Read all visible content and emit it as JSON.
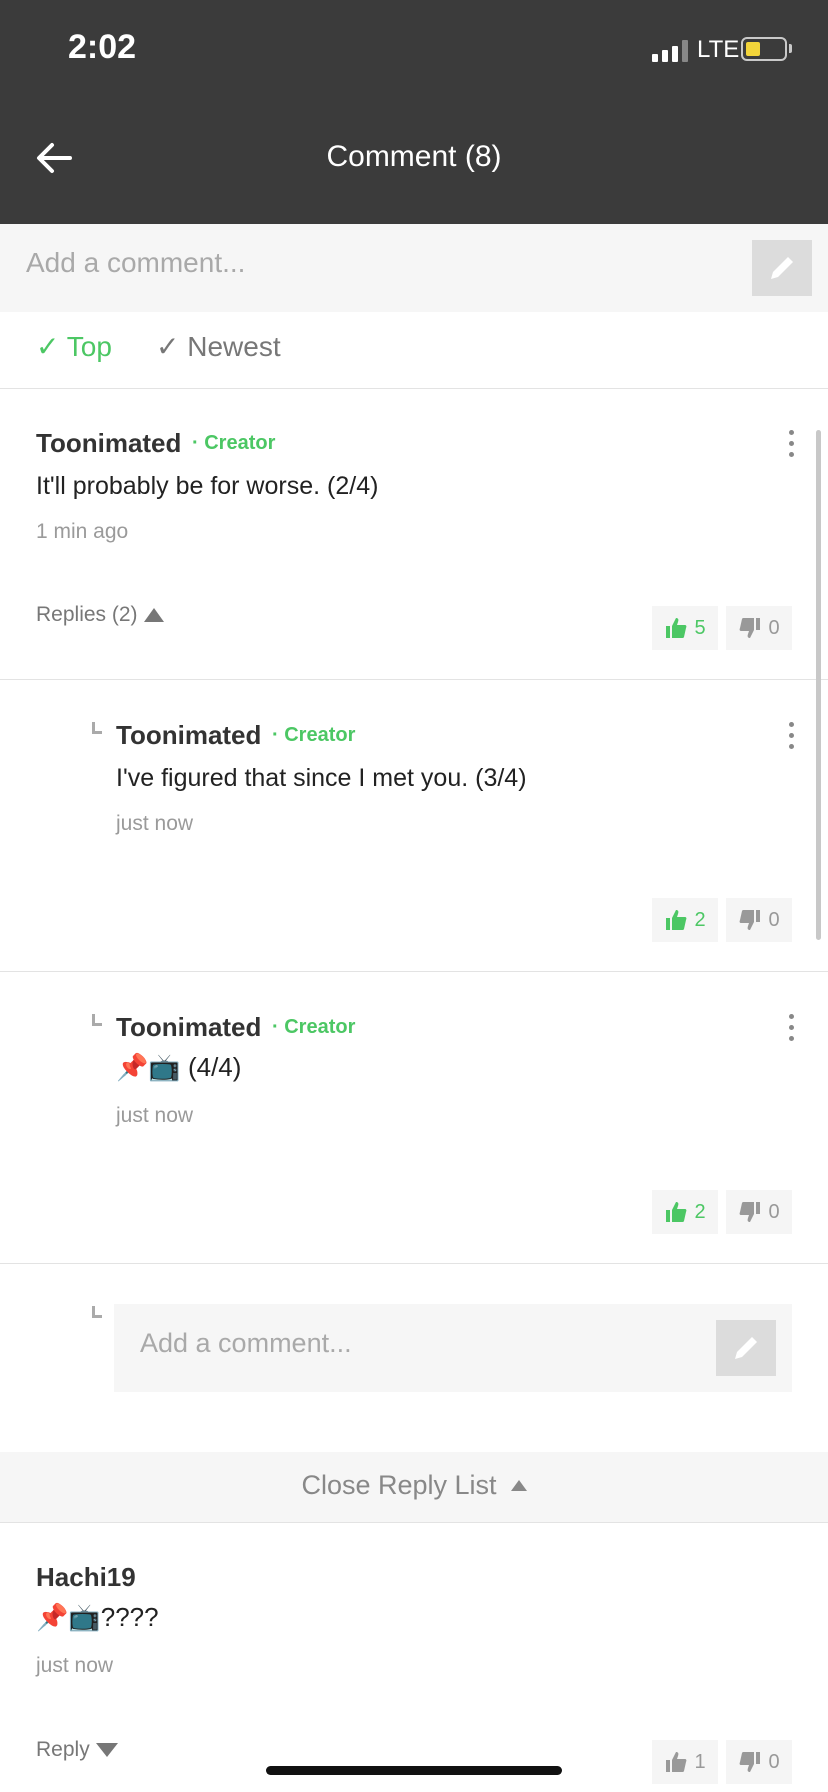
{
  "status": {
    "time": "2:02",
    "network": "LTE"
  },
  "nav": {
    "title": "Comment (8)"
  },
  "add_comment": {
    "placeholder": "Add a comment..."
  },
  "filters": {
    "top": "Top",
    "newest": "Newest",
    "check": "✓"
  },
  "comments": [
    {
      "author": "Toonimated",
      "badge": "· Creator",
      "text": "It'll probably be for worse. (2/4)",
      "time": "1 min ago",
      "replies_label": "Replies (2)",
      "likes": "5",
      "dislikes": "0"
    },
    {
      "author": "Toonimated",
      "badge": "· Creator",
      "text": "I've figured that since I met you. (3/4)",
      "time": "just now",
      "likes": "2",
      "dislikes": "0"
    },
    {
      "author": "Toonimated",
      "badge": "· Creator",
      "text": "📌📺 (4/4)",
      "time": "just now",
      "likes": "2",
      "dislikes": "0"
    },
    {
      "author": "Hachi19",
      "text": "📌📺????",
      "time": "just now",
      "reply_label": "Reply",
      "likes": "1",
      "dislikes": "0"
    }
  ],
  "reply_input": {
    "placeholder": "Add a comment..."
  },
  "close_reply": {
    "label": "Close Reply List"
  },
  "colors": {
    "header": "#3b3b3b",
    "accent_green": "#4cc764",
    "battery": "#f2d43a"
  }
}
